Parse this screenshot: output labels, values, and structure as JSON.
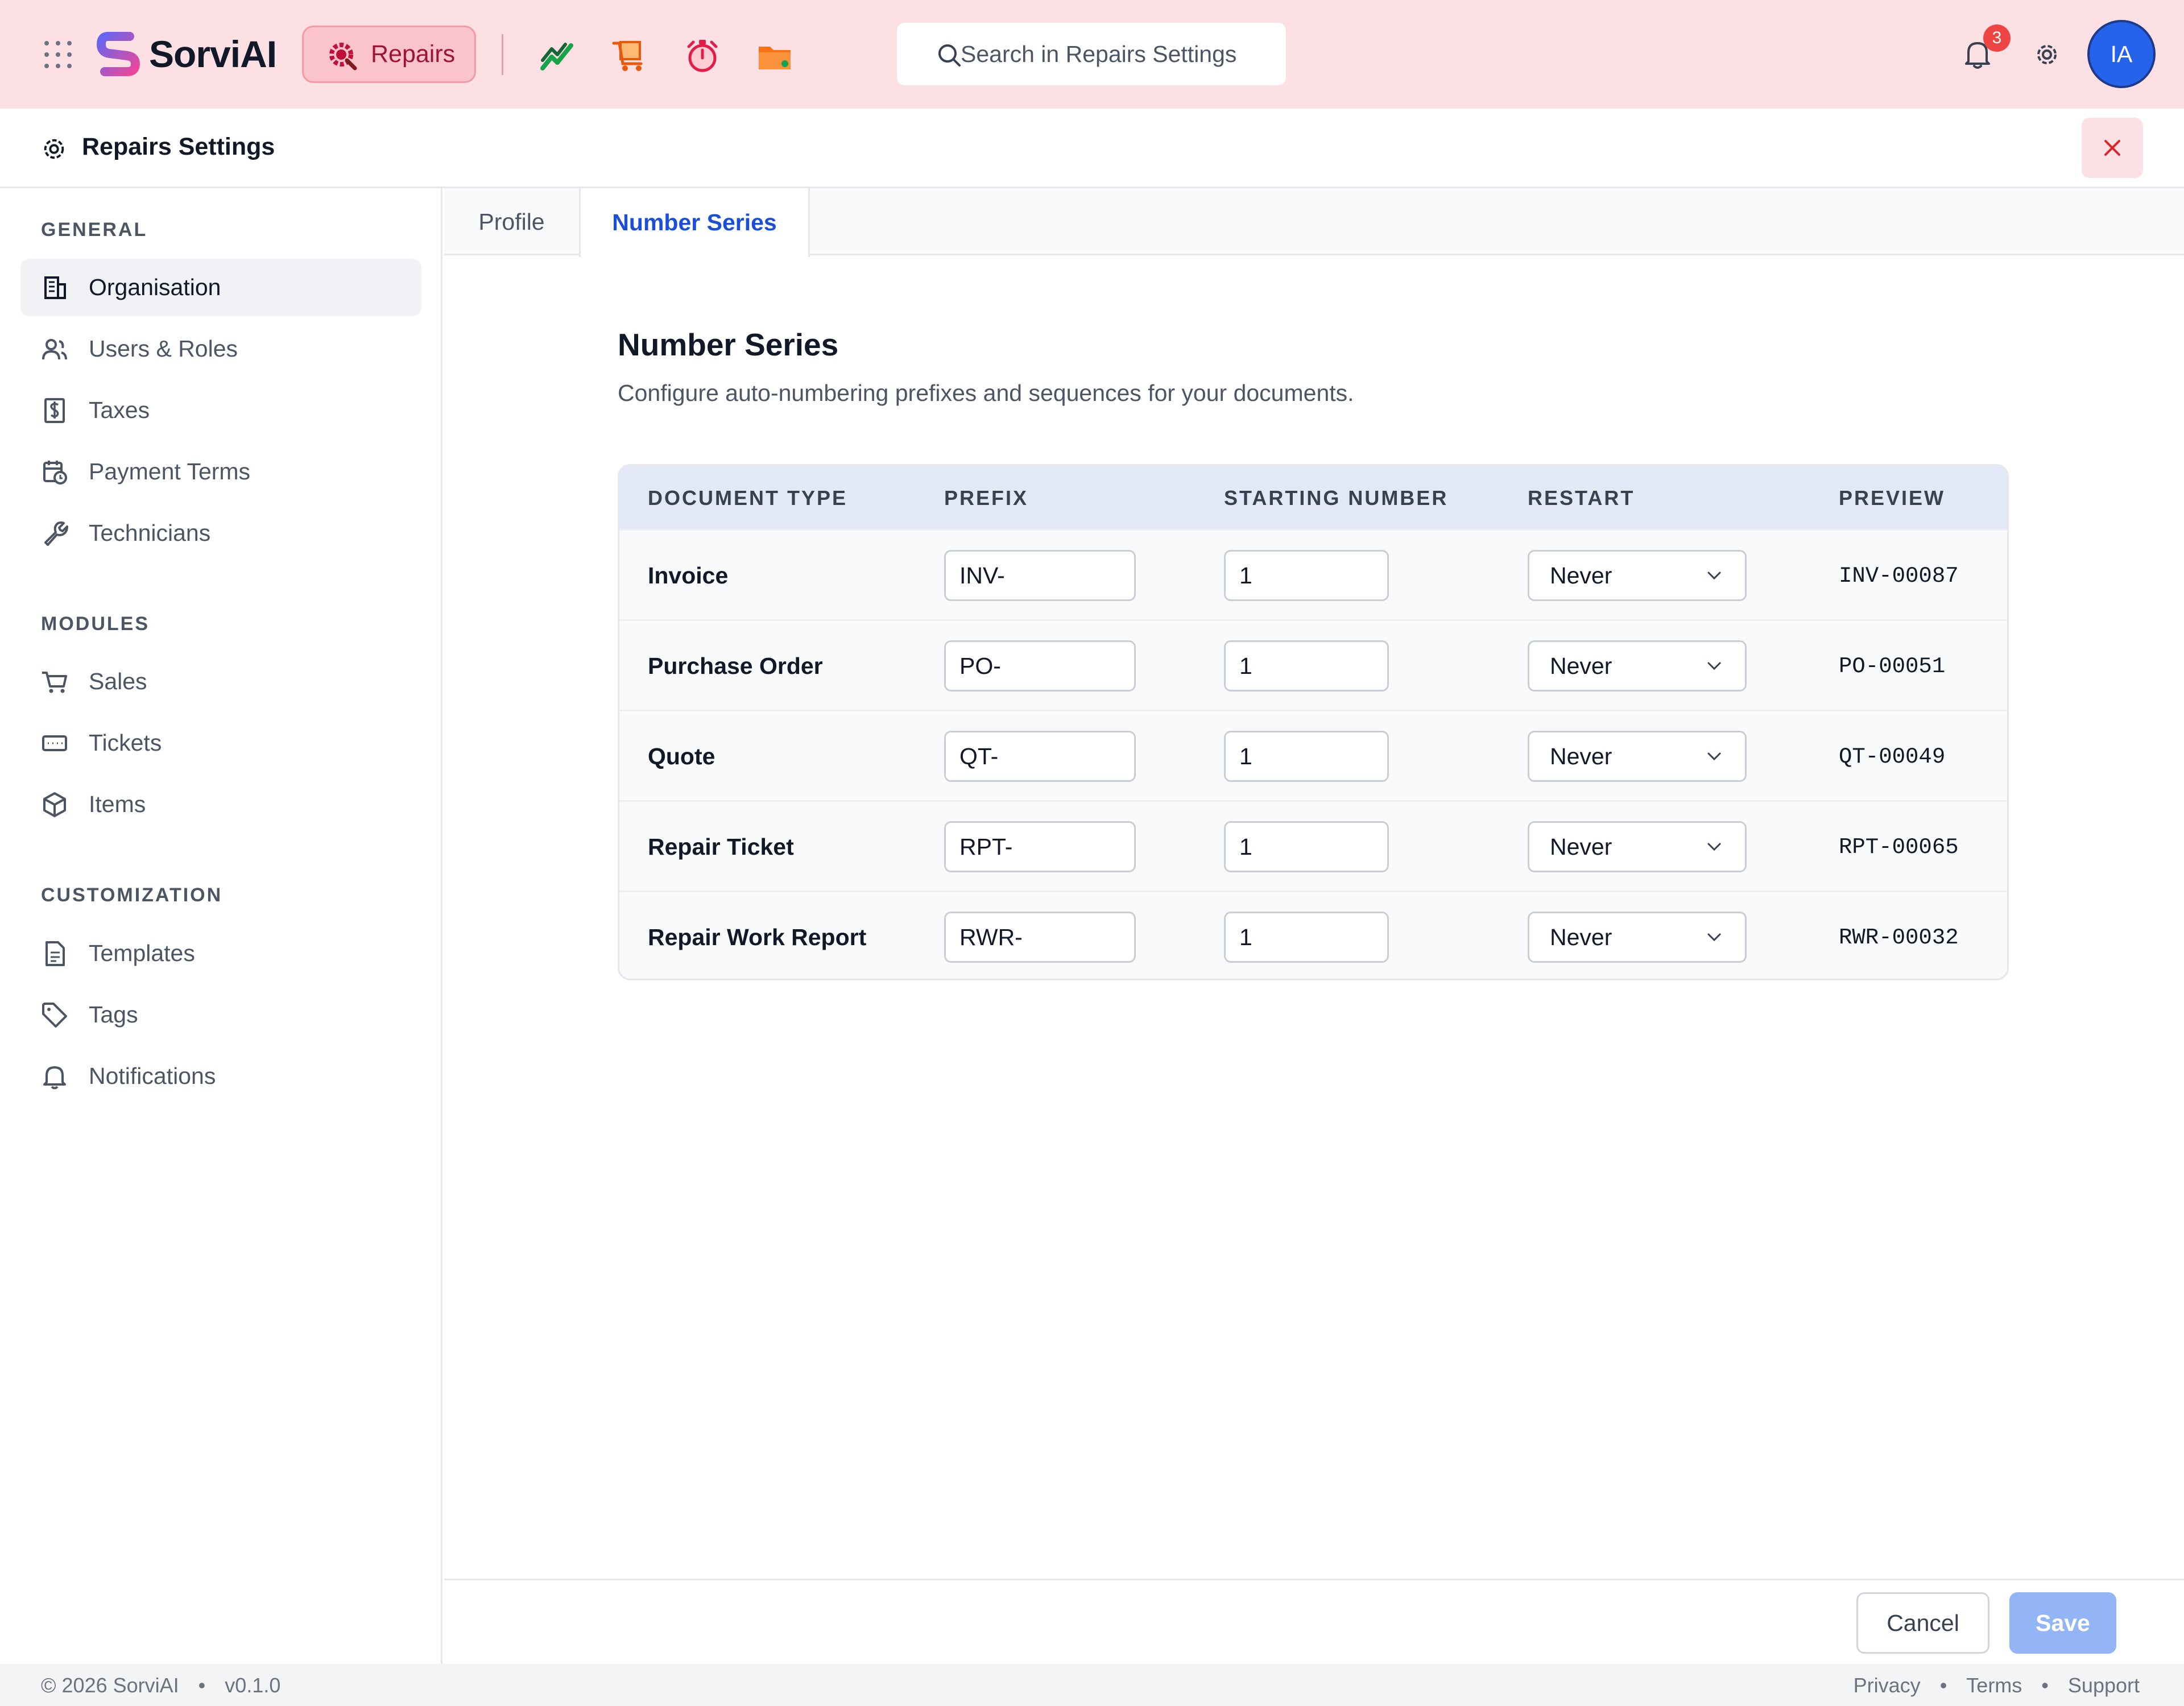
{
  "topbar": {
    "brand": "SorviAI",
    "module_label": "Repairs",
    "search_placeholder": "Search in Repairs Settings",
    "notification_count": "3",
    "avatar_initials": "IA",
    "colors": {
      "bar": "#fde0e3",
      "accent": "#9f1239",
      "avatar": "#2563eb"
    },
    "app_icons": [
      "chart-trend-icon",
      "cart-box-icon",
      "stopwatch-icon",
      "folder-icon"
    ]
  },
  "settings": {
    "title": "Repairs Settings"
  },
  "sidebar": {
    "sections": [
      {
        "title": "GENERAL",
        "items": [
          {
            "label": "Organisation",
            "icon": "building-icon",
            "active": true
          },
          {
            "label": "Users & Roles",
            "icon": "users-icon"
          },
          {
            "label": "Taxes",
            "icon": "dollar-doc-icon"
          },
          {
            "label": "Payment Terms",
            "icon": "calendar-clock-icon"
          },
          {
            "label": "Technicians",
            "icon": "wrench-icon"
          }
        ]
      },
      {
        "title": "MODULES",
        "items": [
          {
            "label": "Sales",
            "icon": "cart-icon"
          },
          {
            "label": "Tickets",
            "icon": "ticket-icon"
          },
          {
            "label": "Items",
            "icon": "box-icon"
          }
        ]
      },
      {
        "title": "CUSTOMIZATION",
        "items": [
          {
            "label": "Templates",
            "icon": "document-icon"
          },
          {
            "label": "Tags",
            "icon": "tag-icon"
          },
          {
            "label": "Notifications",
            "icon": "bell-icon"
          }
        ]
      }
    ]
  },
  "tabs": [
    {
      "label": "Profile",
      "active": false
    },
    {
      "label": "Number Series",
      "active": true
    }
  ],
  "content": {
    "title": "Number Series",
    "subtitle": "Configure auto-numbering prefixes and sequences for your documents.",
    "table": {
      "headers": [
        "DOCUMENT TYPE",
        "PREFIX",
        "STARTING NUMBER",
        "RESTART",
        "PREVIEW"
      ],
      "rows": [
        {
          "doc": "Invoice",
          "prefix": "INV-",
          "start": "1",
          "restart": "Never",
          "preview": "INV-00087"
        },
        {
          "doc": "Purchase Order",
          "prefix": "PO-",
          "start": "1",
          "restart": "Never",
          "preview": "PO-00051"
        },
        {
          "doc": "Quote",
          "prefix": "QT-",
          "start": "1",
          "restart": "Never",
          "preview": "QT-00049"
        },
        {
          "doc": "Repair Ticket",
          "prefix": "RPT-",
          "start": "1",
          "restart": "Never",
          "preview": "RPT-00065"
        },
        {
          "doc": "Repair Work Report",
          "prefix": "RWR-",
          "start": "1",
          "restart": "Never",
          "preview": "RWR-00032"
        }
      ]
    }
  },
  "actions": {
    "cancel": "Cancel",
    "save": "Save"
  },
  "footer": {
    "copyright": "© 2026 SorviAI",
    "version": "v0.1.0",
    "separator": "•",
    "links": [
      "Privacy",
      "Terms",
      "Support"
    ]
  }
}
